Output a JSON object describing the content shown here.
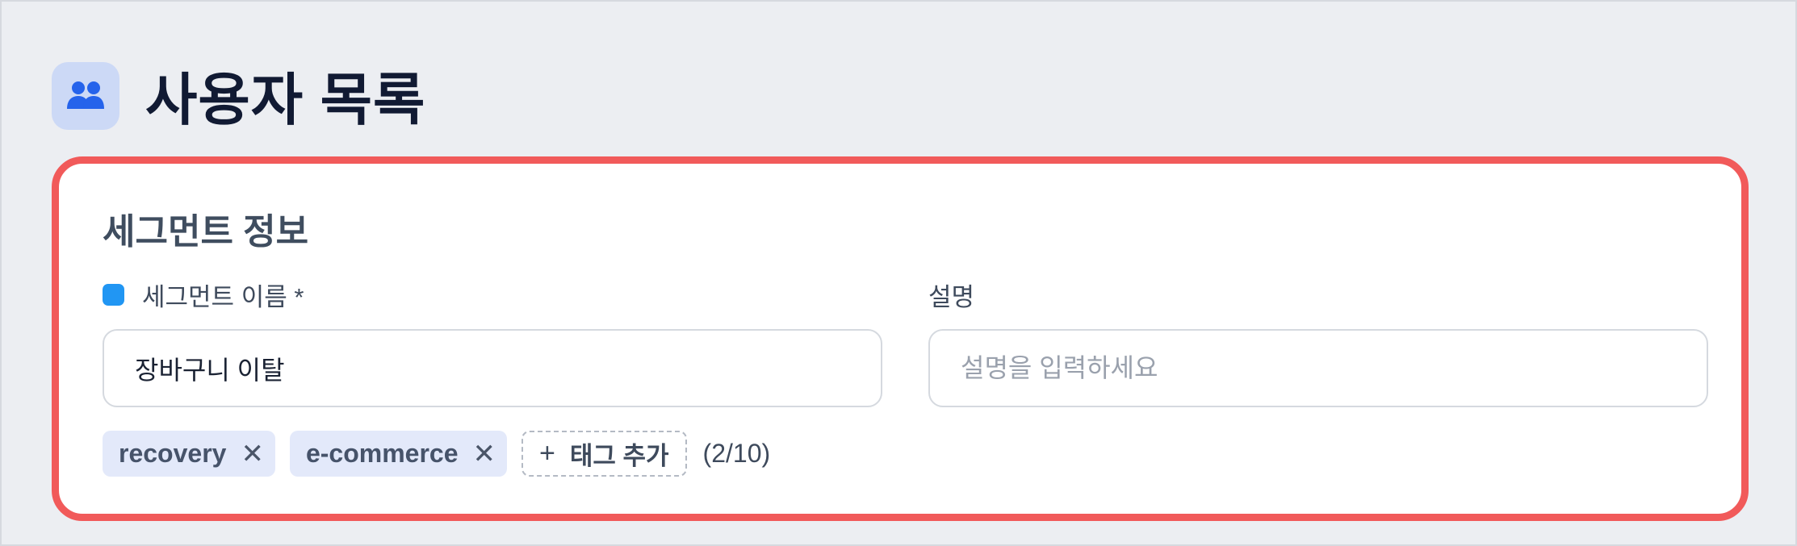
{
  "header": {
    "icon": "users-icon",
    "title": "사용자 목록"
  },
  "segment_card": {
    "section_title": "세그먼트 정보",
    "name_field": {
      "label": "세그먼트 이름 *",
      "value": "장바구니 이탈",
      "indicator_color": "#2196f3"
    },
    "description_field": {
      "label": "설명",
      "value": "",
      "placeholder": "설명을 입력하세요"
    },
    "tags": [
      {
        "label": "recovery",
        "remove_icon": "✕"
      },
      {
        "label": "e-commerce",
        "remove_icon": "✕"
      }
    ],
    "add_tag": {
      "icon": "+",
      "label": "태그 추가"
    },
    "tag_count": "(2/10)"
  },
  "colors": {
    "highlight_border": "#f15a5a",
    "accent_blue": "#2563eb",
    "tag_bg": "#e3e9fa"
  }
}
